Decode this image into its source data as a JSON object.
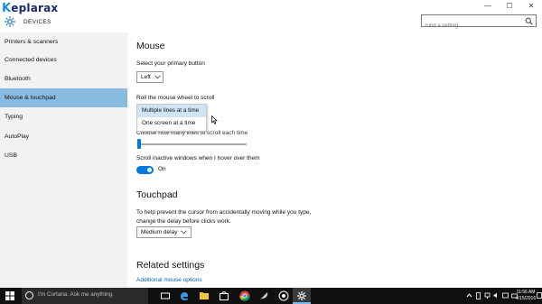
{
  "header": {
    "logo_first": "K",
    "logo_rest": "eplarax",
    "section_title": "DEVICES",
    "search_placeholder": "Find a setting",
    "minimize": "—",
    "maximize": "☐",
    "close": "✕"
  },
  "sidebar": {
    "items": [
      {
        "label": "Printers & scanners"
      },
      {
        "label": "Connected devices"
      },
      {
        "label": "Bluetooth"
      },
      {
        "label": "Mouse & touchpad"
      },
      {
        "label": "Typing"
      },
      {
        "label": "AutoPlay"
      },
      {
        "label": "USB"
      }
    ],
    "active_index": 3
  },
  "main": {
    "mouse_heading": "Mouse",
    "primary_button_label": "Select your primary button",
    "primary_button_value": "Left",
    "scroll_wheel_label": "Roll the mouse wheel to scroll",
    "scroll_options": [
      "Multiple lines at a time",
      "One screen at a time"
    ],
    "scroll_selected": "Multiple lines at a time",
    "lines_label": "Choose how many lines to scroll each time",
    "lines_slider_fraction": 0.01,
    "inactive_scroll_label": "Scroll inactive windows when I hover over them",
    "inactive_scroll_state": "On",
    "touchpad_heading": "Touchpad",
    "touchpad_description": "To help prevent the cursor from accidentally moving while you type, change the delay before clicks work.",
    "touchpad_delay_value": "Medium delay",
    "related_heading": "Related settings",
    "related_link": "Additional mouse options"
  },
  "taskbar": {
    "cortana_placeholder": "I'm Cortana. Ask me anything.",
    "clock_time": "11:56 AM",
    "clock_date": "4/15/2016"
  },
  "colors": {
    "accent": "#0078d7",
    "sidebar_active": "#89bbe0",
    "link": "#0063b1",
    "taskbar": "#101010"
  }
}
